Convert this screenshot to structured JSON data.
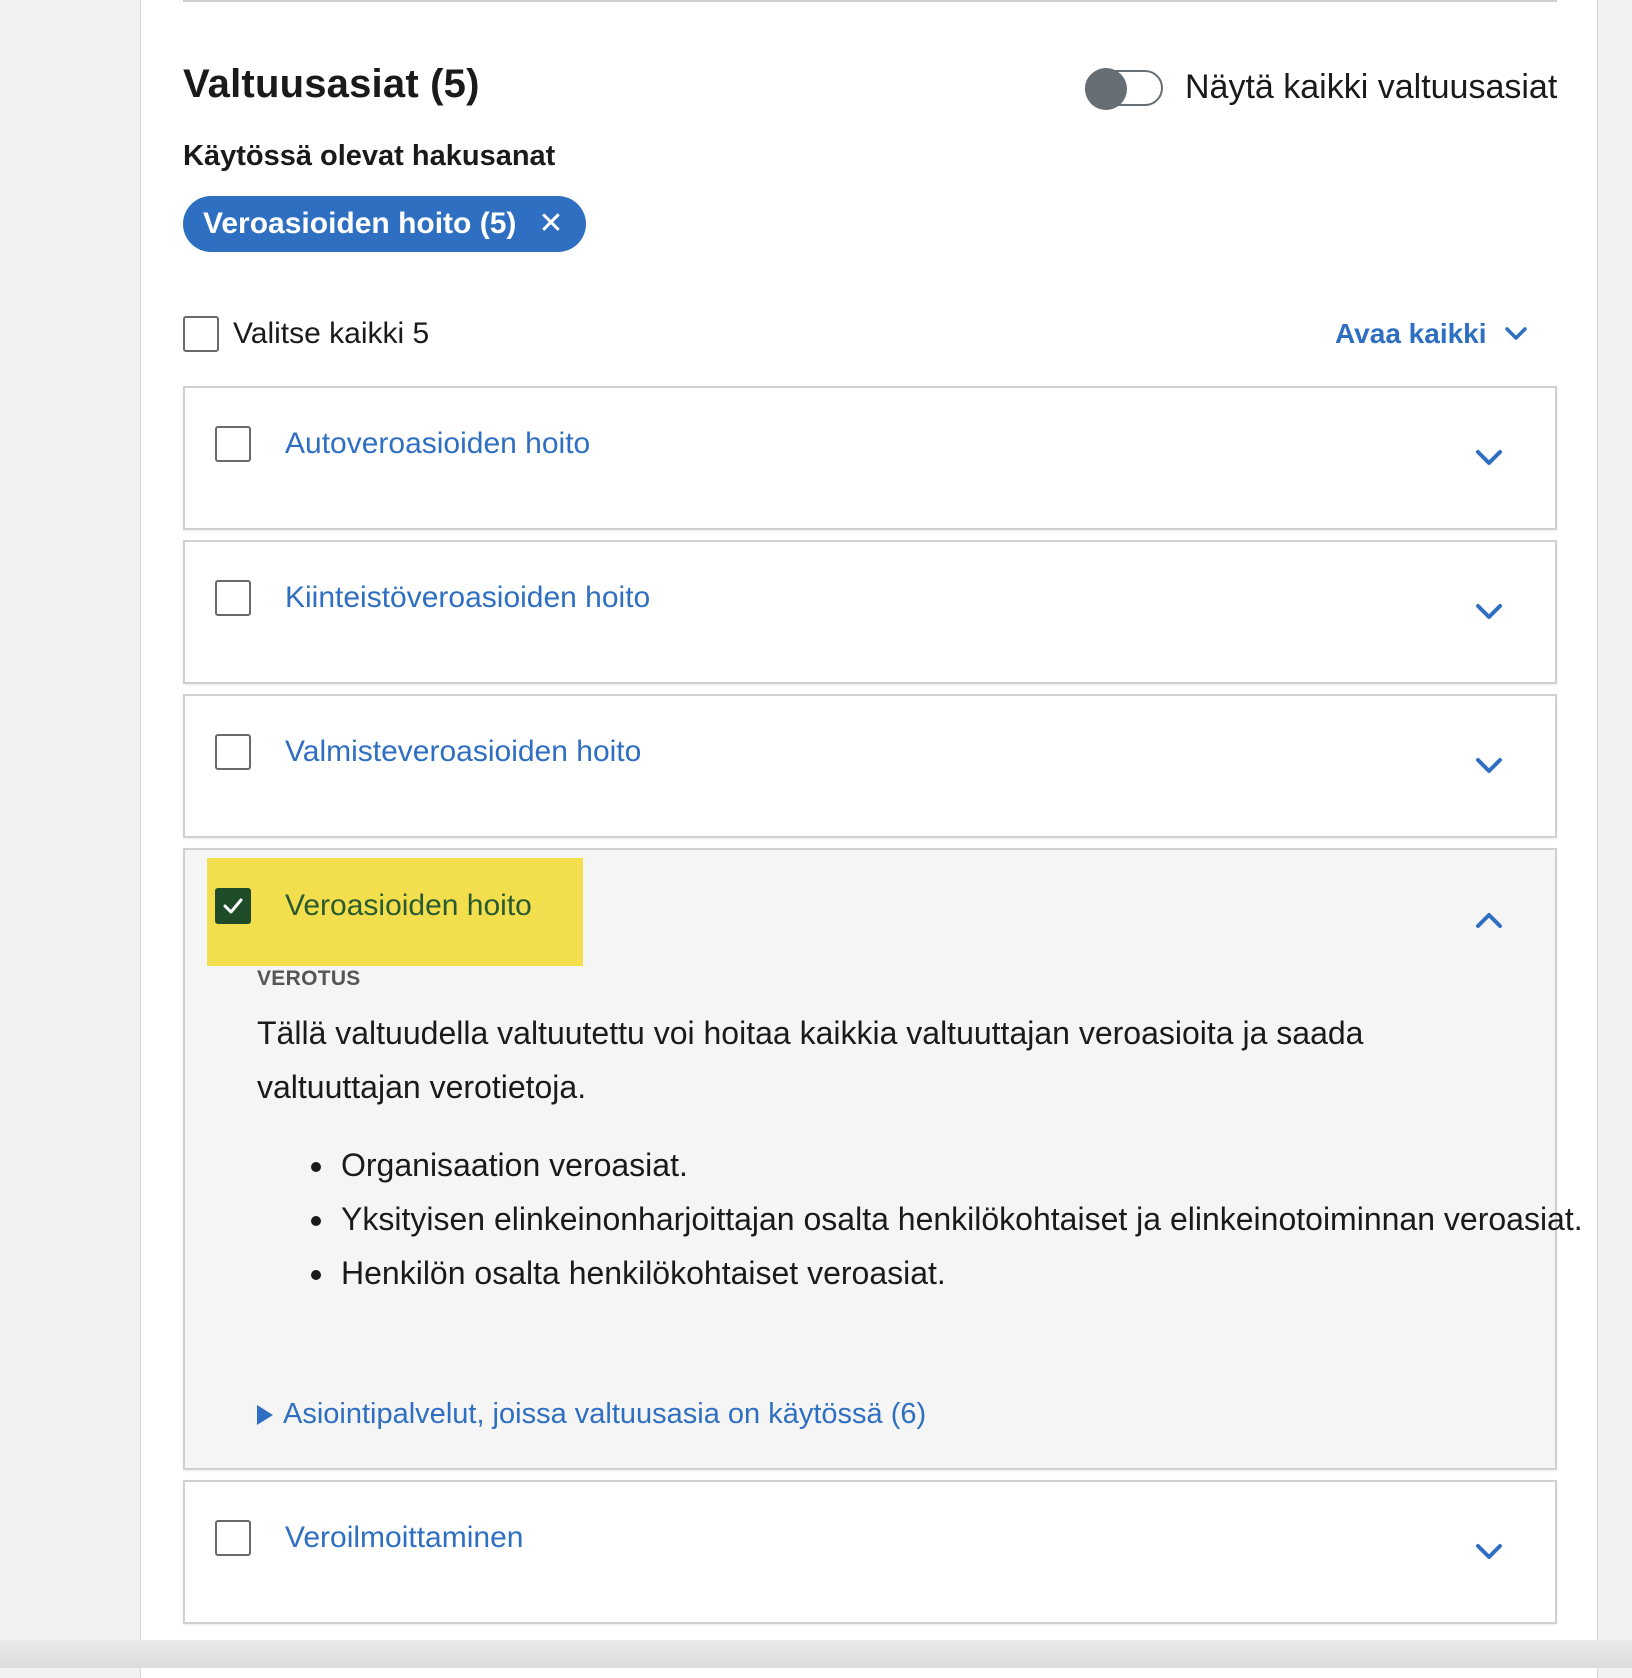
{
  "header": {
    "title": "Valtuusasiat (5)",
    "toggle_label": "Näytä kaikki valtuusasiat",
    "toggle_on": false
  },
  "filters": {
    "heading": "Käytössä olevat hakusanat",
    "chips": [
      {
        "label": "Veroasioiden hoito (5)"
      }
    ]
  },
  "list_controls": {
    "select_all_label": "Valitse kaikki 5",
    "open_all_label": "Avaa kaikki"
  },
  "items": [
    {
      "label": "Autoveroasioiden hoito",
      "checked": false,
      "expanded": false
    },
    {
      "label": "Kiinteistöveroasioiden hoito",
      "checked": false,
      "expanded": false
    },
    {
      "label": "Valmisteveroasioiden hoito",
      "checked": false,
      "expanded": false
    },
    {
      "label": "Veroasioiden hoito",
      "checked": true,
      "expanded": true,
      "category": "VEROTUS",
      "description": "Tällä valtuudella valtuutettu voi hoitaa kaikkia valtuuttajan veroasioita ja saada valtuuttajan verotietoja.",
      "bullets": [
        "Organisaation veroasiat.",
        "Yksityisen elinkeinonharjoittajan osalta henkilökohtaiset ja elinkeinotoiminnan veroasiat.",
        "Henkilön osalta henkilökohtaiset veroasiat."
      ],
      "services_link": "Asiointipalvelut, joissa valtuusasia on käytössä (6)"
    },
    {
      "label": "Veroilmoittaminen",
      "checked": false,
      "expanded": false
    }
  ],
  "colors": {
    "link_blue": "#2f6fc1",
    "highlight_yellow": "#f3df4d",
    "check_green": "#1e4b28"
  }
}
